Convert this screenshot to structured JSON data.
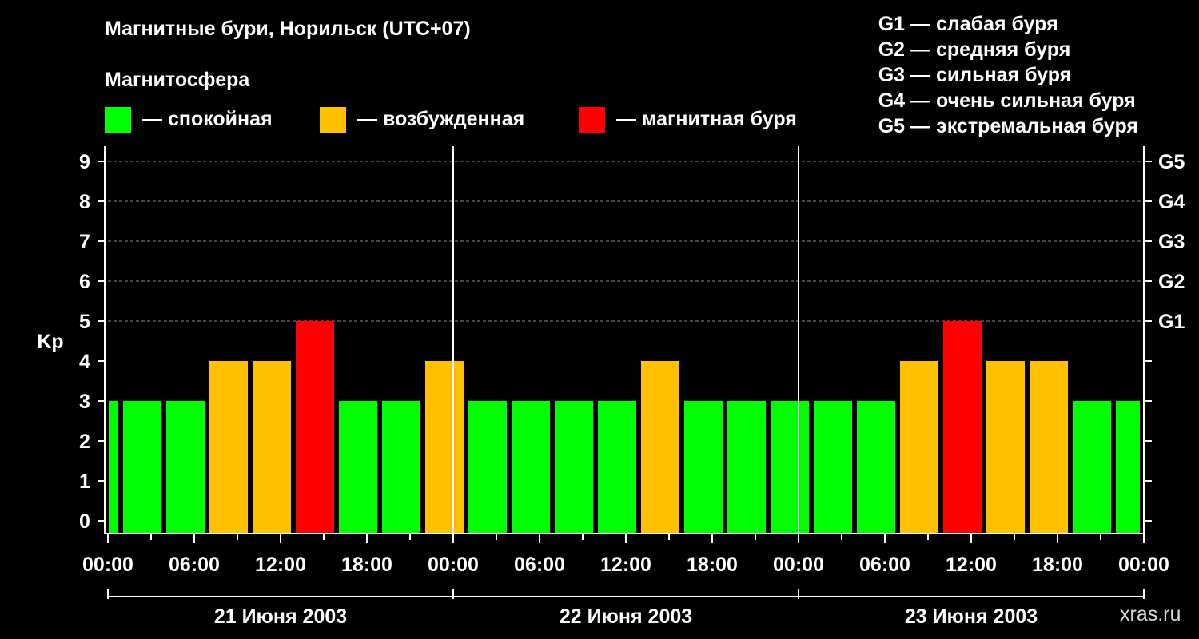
{
  "title": "Магнитные бури, Норильск (UTC+07)",
  "legend": {
    "heading": "Магнитосфера",
    "items": [
      {
        "label": "— спокойная",
        "color": "#00ff00"
      },
      {
        "label": "— возбужденная",
        "color": "#ffc000"
      },
      {
        "label": "— магнитная буря",
        "color": "#ff0000"
      }
    ]
  },
  "g_scale_legend": [
    "G1 — слабая буря",
    "G2 — средняя буря",
    "G3 — сильная буря",
    "G4 — очень сильная буря",
    "G5 — экстремальная буря"
  ],
  "watermark": "xras.ru",
  "chart_data": {
    "type": "bar",
    "ylabel": "Kp",
    "ylim": [
      0,
      9
    ],
    "y_ticks": [
      "0",
      "1",
      "2",
      "3",
      "4",
      "5",
      "6",
      "7",
      "8",
      "9"
    ],
    "g_ticks": [
      {
        "kp": 5,
        "label": "G1"
      },
      {
        "kp": 6,
        "label": "G2"
      },
      {
        "kp": 7,
        "label": "G3"
      },
      {
        "kp": 8,
        "label": "G4"
      },
      {
        "kp": 9,
        "label": "G5"
      }
    ],
    "x_tick_labels": [
      "00:00",
      "06:00",
      "12:00",
      "18:00",
      "00:00",
      "06:00",
      "12:00",
      "18:00",
      "00:00",
      "06:00",
      "12:00",
      "18:00",
      "00:00"
    ],
    "day_labels": [
      "21 Июня 2003",
      "22 Июня 2003",
      "23 Июня 2003"
    ],
    "grid": "dashed horizontal at Kp 5–9",
    "colors": {
      "quiet": "#00ff00",
      "active": "#ffc000",
      "storm": "#ff0000"
    },
    "bars": [
      {
        "start_h": 0,
        "end_h": 1,
        "kp": 3,
        "status": "quiet"
      },
      {
        "start_h": 1,
        "end_h": 4,
        "kp": 3,
        "status": "quiet"
      },
      {
        "start_h": 4,
        "end_h": 7,
        "kp": 3,
        "status": "quiet"
      },
      {
        "start_h": 7,
        "end_h": 10,
        "kp": 4,
        "status": "active"
      },
      {
        "start_h": 10,
        "end_h": 13,
        "kp": 4,
        "status": "active"
      },
      {
        "start_h": 13,
        "end_h": 16,
        "kp": 5,
        "status": "storm"
      },
      {
        "start_h": 16,
        "end_h": 19,
        "kp": 3,
        "status": "quiet"
      },
      {
        "start_h": 19,
        "end_h": 22,
        "kp": 3,
        "status": "quiet"
      },
      {
        "start_h": 22,
        "end_h": 25,
        "kp": 4,
        "status": "active"
      },
      {
        "start_h": 25,
        "end_h": 28,
        "kp": 3,
        "status": "quiet"
      },
      {
        "start_h": 28,
        "end_h": 31,
        "kp": 3,
        "status": "quiet"
      },
      {
        "start_h": 31,
        "end_h": 34,
        "kp": 3,
        "status": "quiet"
      },
      {
        "start_h": 34,
        "end_h": 37,
        "kp": 3,
        "status": "quiet"
      },
      {
        "start_h": 37,
        "end_h": 40,
        "kp": 4,
        "status": "active"
      },
      {
        "start_h": 40,
        "end_h": 43,
        "kp": 3,
        "status": "quiet"
      },
      {
        "start_h": 43,
        "end_h": 46,
        "kp": 3,
        "status": "quiet"
      },
      {
        "start_h": 46,
        "end_h": 49,
        "kp": 3,
        "status": "quiet"
      },
      {
        "start_h": 49,
        "end_h": 52,
        "kp": 3,
        "status": "quiet"
      },
      {
        "start_h": 52,
        "end_h": 55,
        "kp": 3,
        "status": "quiet"
      },
      {
        "start_h": 55,
        "end_h": 58,
        "kp": 4,
        "status": "active"
      },
      {
        "start_h": 58,
        "end_h": 61,
        "kp": 5,
        "status": "storm"
      },
      {
        "start_h": 61,
        "end_h": 64,
        "kp": 4,
        "status": "active"
      },
      {
        "start_h": 64,
        "end_h": 67,
        "kp": 4,
        "status": "active"
      },
      {
        "start_h": 67,
        "end_h": 70,
        "kp": 3,
        "status": "quiet"
      },
      {
        "start_h": 70,
        "end_h": 72,
        "kp": 3,
        "status": "quiet"
      }
    ]
  }
}
